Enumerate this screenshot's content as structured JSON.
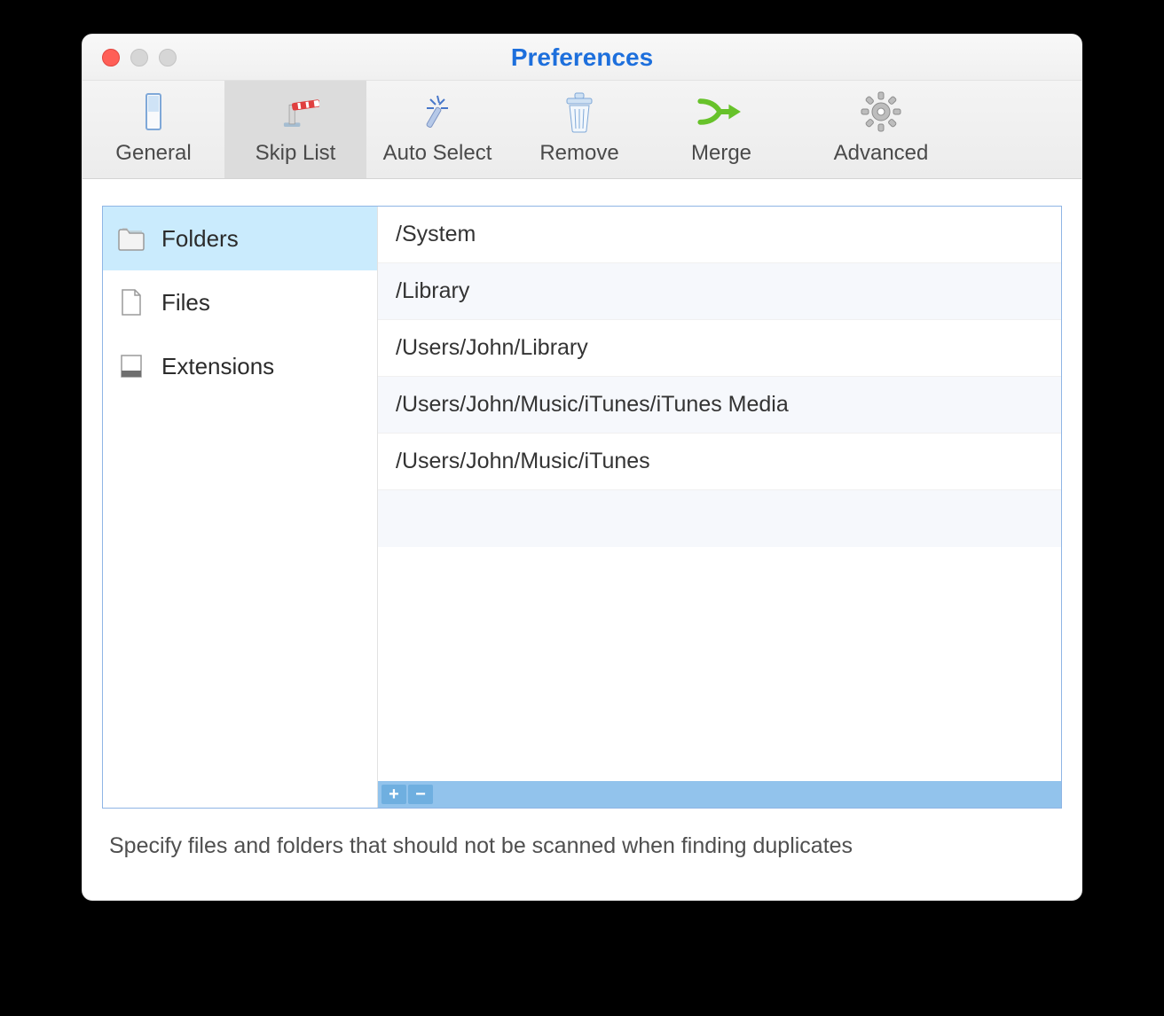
{
  "window": {
    "title": "Preferences"
  },
  "toolbar": {
    "items": [
      {
        "label": "General"
      },
      {
        "label": "Skip List"
      },
      {
        "label": "Auto Select"
      },
      {
        "label": "Remove"
      },
      {
        "label": "Merge"
      },
      {
        "label": "Advanced"
      }
    ],
    "active_index": 1
  },
  "sidebar": {
    "items": [
      {
        "label": "Folders"
      },
      {
        "label": "Files"
      },
      {
        "label": "Extensions"
      }
    ],
    "selected_index": 0
  },
  "skip_list": {
    "rows": [
      "/System",
      "/Library",
      "/Users/John/Library",
      "/Users/John/Music/iTunes/iTunes Media",
      "/Users/John/Music/iTunes"
    ]
  },
  "footer": {
    "add_label": "+",
    "remove_label": "−"
  },
  "help_text": "Specify files and folders that should not be scanned when finding duplicates"
}
